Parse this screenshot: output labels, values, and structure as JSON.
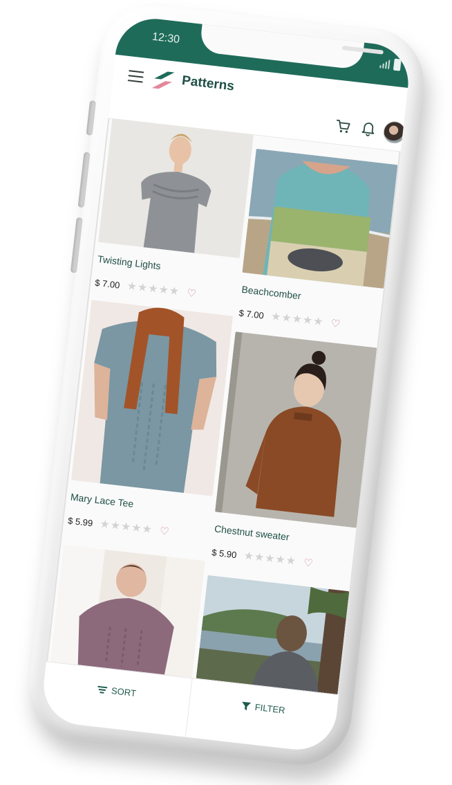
{
  "status_bar": {
    "time": "12:30"
  },
  "app_bar": {
    "title": "Patterns"
  },
  "products": [
    {
      "name": "Twisting Lights",
      "price": "$ 7.00",
      "rating_stars": "★★★★★",
      "rating": 0
    },
    {
      "name": "Beachcomber",
      "price": "$ 7.00",
      "rating_stars": "★★★★★",
      "rating": 0
    },
    {
      "name": "Mary Lace Tee",
      "price": "$ 5.99",
      "rating_stars": "★★★★★",
      "rating": 0
    },
    {
      "name": "Chestnut sweater",
      "price": "$ 5.90",
      "rating_stars": "★★★★★",
      "rating": 0
    }
  ],
  "bottom_bar": {
    "sort_label": "SORT",
    "filter_label": "FILTER"
  },
  "icons": {
    "favorite": "♡"
  },
  "colors": {
    "brand": "#1f6b5a",
    "title_text": "#1f4f45",
    "heart": "#c47b8b",
    "star_empty": "#d3d3d3"
  }
}
